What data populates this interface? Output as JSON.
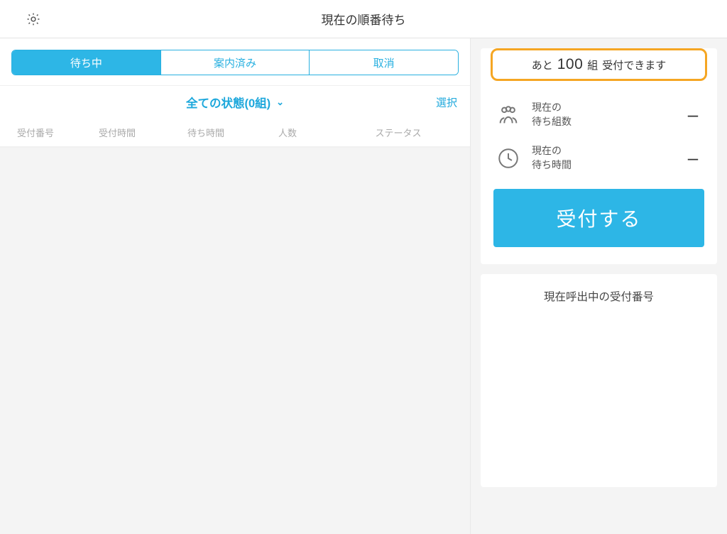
{
  "header": {
    "title": "現在の順番待ち"
  },
  "tabs": {
    "waiting": "待ち中",
    "served": "案内済み",
    "cancelled": "取消"
  },
  "filter": {
    "label": "全ての状態(0組)",
    "select_label": "選択"
  },
  "columns": {
    "c0": "受付番号",
    "c1": "受付時間",
    "c2": "待ち時間",
    "c3": "人数",
    "c4": "ステータス"
  },
  "availability": {
    "pre": "あと",
    "count": "100",
    "unit": "組",
    "post": "受付できます"
  },
  "stats": {
    "groups_l1": "現在の",
    "groups_l2": "待ち組数",
    "groups_val": "–",
    "time_l1": "現在の",
    "time_l2": "待ち時間",
    "time_val": "–"
  },
  "accept_label": "受付する",
  "calling_title": "現在呼出中の受付番号"
}
